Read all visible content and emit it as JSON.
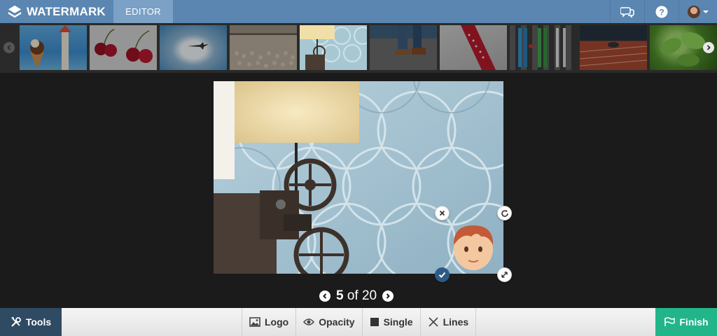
{
  "app": {
    "brand": "WATERMARK",
    "active_tab": "EDITOR"
  },
  "header_icons": [
    "chat-icon",
    "help-icon",
    "user-avatar"
  ],
  "thumbnails": [
    {
      "alt": "ice cream cone",
      "active": false
    },
    {
      "alt": "cherries",
      "active": false
    },
    {
      "alt": "airplane in sky",
      "active": false
    },
    {
      "alt": "firewood stack",
      "active": false
    },
    {
      "alt": "projector and lamp",
      "active": true
    },
    {
      "alt": "walking feet",
      "active": false
    },
    {
      "alt": "red tie",
      "active": false
    },
    {
      "alt": "skis",
      "active": false
    },
    {
      "alt": "running track",
      "active": false
    },
    {
      "alt": "green leaves",
      "active": false
    }
  ],
  "pager": {
    "current": "5",
    "of_label": "of 20"
  },
  "toolbar": {
    "tools_label": "Tools",
    "logo_label": "Logo",
    "opacity_label": "Opacity",
    "single_label": "Single",
    "lines_label": "Lines",
    "finish_label": "Finish"
  },
  "colors": {
    "header": "#5a86b1",
    "tab_active": "#7ba1c6",
    "tools": "#2f4a63",
    "finish": "#22b58a",
    "background": "#1b1b1b"
  }
}
